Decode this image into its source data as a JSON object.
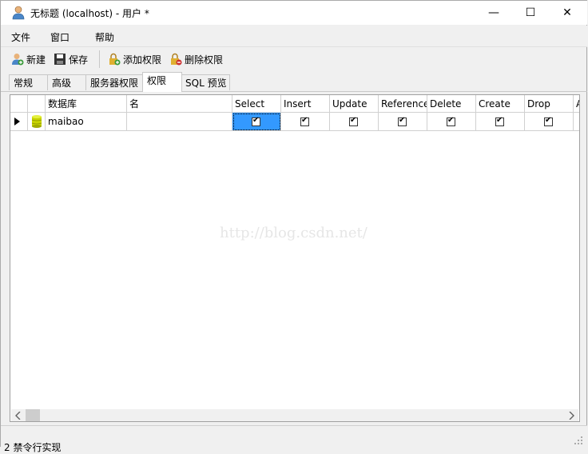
{
  "window": {
    "title": "无标题 (localhost) - 用户 *",
    "minimize": "—",
    "maximize": "☐",
    "close": "✕"
  },
  "menu": [
    "文件",
    "窗口",
    "帮助"
  ],
  "toolbar": {
    "new_label": "新建",
    "save_label": "保存",
    "add_priv_label": "添加权限",
    "del_priv_label": "删除权限"
  },
  "tabs": [
    "常规",
    "高级",
    "服务器权限",
    "权限",
    "SQL 预览"
  ],
  "active_tab": "权限",
  "grid": {
    "columns": [
      "数据库",
      "名",
      "Select",
      "Insert",
      "Update",
      "Reference",
      "Delete",
      "Create",
      "Drop",
      "A"
    ],
    "rows": [
      {
        "database": "maibao",
        "name": "",
        "select": true,
        "insert": true,
        "update": true,
        "reference": true,
        "delete": true,
        "create": true,
        "drop": true
      }
    ]
  },
  "watermark": "http://blog.csdn.net/",
  "status": "2 禁令行实现",
  "colors": {
    "selection": "#3399ff",
    "db_icon": "#c8d400"
  }
}
